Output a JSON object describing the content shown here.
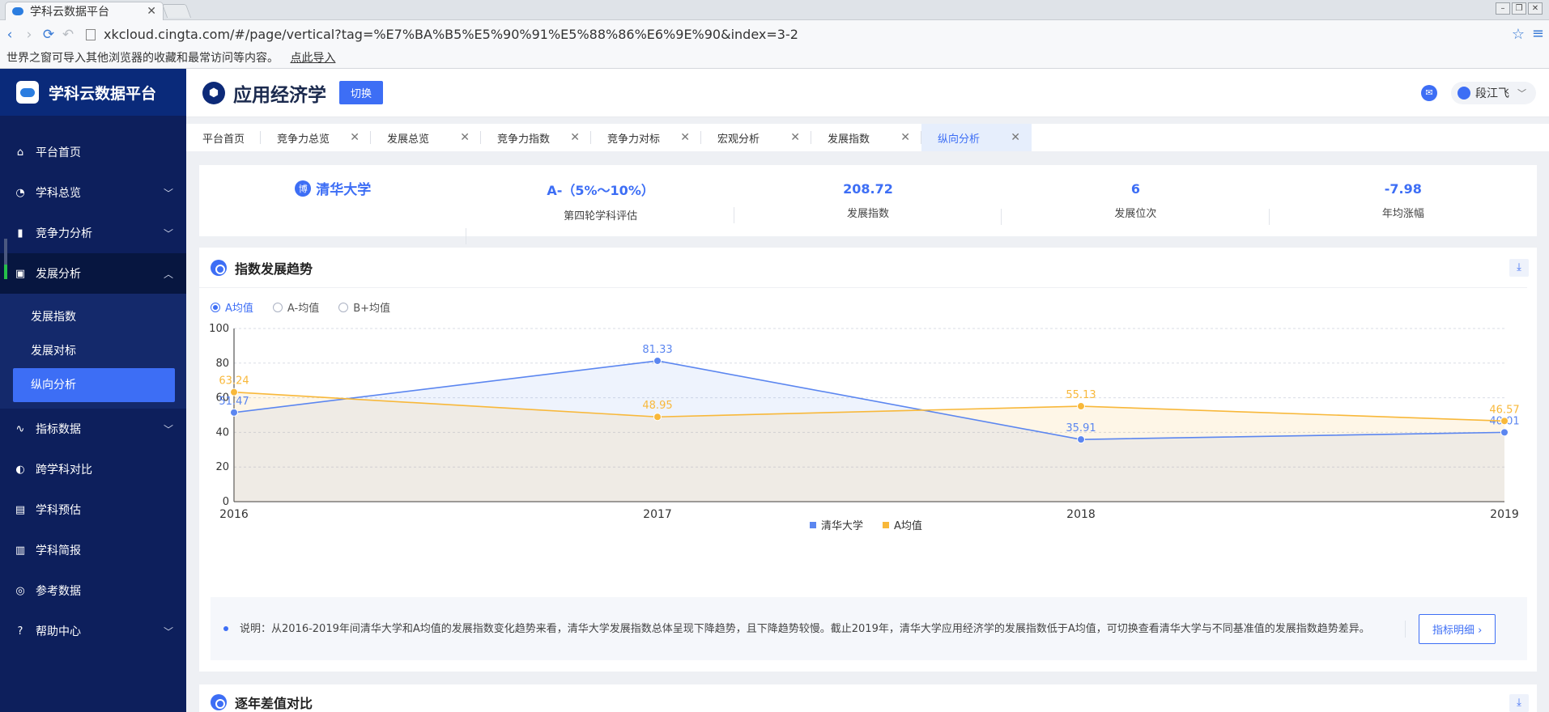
{
  "browser": {
    "tab_title": "学科云数据平台",
    "url": "xkcloud.cingta.com/#/page/vertical?tag=%E7%BA%B5%E5%90%91%E5%88%86%E6%9E%90&index=3-2",
    "bookmark_text": "世界之窗可导入其他浏览器的收藏和最常访问等内容。",
    "bookmark_link": "点此导入"
  },
  "sidebar": {
    "brand": "学科云数据平台",
    "items": [
      {
        "label": "平台首页",
        "icon": "home-icon"
      },
      {
        "label": "学科总览",
        "icon": "pie-icon"
      },
      {
        "label": "竞争力分析",
        "icon": "bar-chart-icon"
      },
      {
        "label": "发展分析",
        "icon": "trend-icon"
      },
      {
        "label": "指标数据",
        "icon": "wave-icon"
      },
      {
        "label": "跨学科对比",
        "icon": "half-circle-icon"
      },
      {
        "label": "学科预估",
        "icon": "doc-icon"
      },
      {
        "label": "学科简报",
        "icon": "list-icon"
      },
      {
        "label": "参考数据",
        "icon": "target-icon"
      },
      {
        "label": "帮助中心",
        "icon": "help-icon"
      }
    ],
    "sub_items": [
      "发展指数",
      "发展对标",
      "纵向分析"
    ]
  },
  "header": {
    "subject": "应用经济学",
    "switch_label": "切换",
    "user": "段江飞"
  },
  "page_tabs": [
    "平台首页",
    "竞争力总览",
    "发展总览",
    "竞争力指数",
    "竞争力对标",
    "宏观分析",
    "发展指数",
    "纵向分析"
  ],
  "summary": {
    "university": "清华大学",
    "badge": "博",
    "grade_value": "A-（5%～10%）",
    "grade_label": "第四轮学科评估",
    "index_value": "208.72",
    "index_label": "发展指数",
    "rank_value": "6",
    "rank_label": "发展位次",
    "growth_value": "-7.98",
    "growth_label": "年均涨幅"
  },
  "trend": {
    "title": "指数发展趋势",
    "radios": [
      "A均值",
      "A-均值",
      "B+均值"
    ],
    "selected_radio": "A均值",
    "note": "说明：从2016-2019年间清华大学和A均值的发展指数变化趋势来看，清华大学发展指数总体呈现下降趋势，且下降趋势较慢。截止2019年，清华大学应用经济学的发展指数低于A均值，可切换查看清华大学与不同基准值的发展指数趋势差异。",
    "detail_button": "指标明细 ›"
  },
  "diff_card": {
    "title": "逐年差值对比"
  },
  "chart_data": {
    "type": "line",
    "x": [
      "2016",
      "2017",
      "2018",
      "2019"
    ],
    "ylim": [
      0,
      100
    ],
    "yticks": [
      0,
      20,
      40,
      60,
      80,
      100
    ],
    "grid": true,
    "legend": "bottom-center",
    "series": [
      {
        "name": "清华大学",
        "values": [
          51.47,
          81.33,
          35.91,
          40.01
        ],
        "color": "#5b86f0"
      },
      {
        "name": "A均值",
        "values": [
          63.24,
          48.95,
          55.13,
          46.57
        ],
        "color": "#f8b83a"
      }
    ],
    "labels": [
      [
        "51.47",
        "81.33",
        "35.91",
        "40.01"
      ],
      [
        "63.24",
        "48.95",
        "55.13",
        "46.57"
      ]
    ]
  }
}
